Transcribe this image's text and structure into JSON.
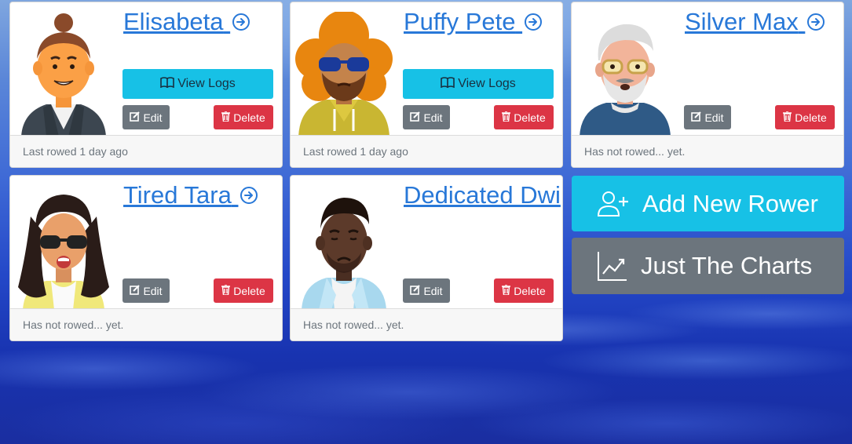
{
  "rowers": [
    {
      "name": "Elisabeta",
      "status": "Last rowed 1 day ago",
      "has_logs": true
    },
    {
      "name": "Puffy Pete",
      "status": "Last rowed 1 day ago",
      "has_logs": true
    },
    {
      "name": "Silver Max",
      "status": "Has not rowed... yet.",
      "has_logs": false
    },
    {
      "name": "Tired Tara",
      "status": "Has not rowed... yet.",
      "has_logs": false
    },
    {
      "name": "Dedicated Dwi",
      "status": "Has not rowed... yet.",
      "has_logs": false
    }
  ],
  "labels": {
    "view_logs": "View Logs",
    "edit": "Edit",
    "delete": "Delete"
  },
  "actions": {
    "add_rower": "Add New Rower",
    "just_charts": "Just The Charts"
  },
  "colors": {
    "info": "#17c1e6",
    "secondary": "#6c757d",
    "danger": "#dc3545",
    "link": "#2878d8"
  },
  "icons": {
    "view_logs": "book-icon",
    "edit": "edit-icon",
    "delete": "trash-icon",
    "name_link": "arrow-circle-right-icon",
    "add_rower": "user-plus-icon",
    "just_charts": "chart-line-icon"
  }
}
